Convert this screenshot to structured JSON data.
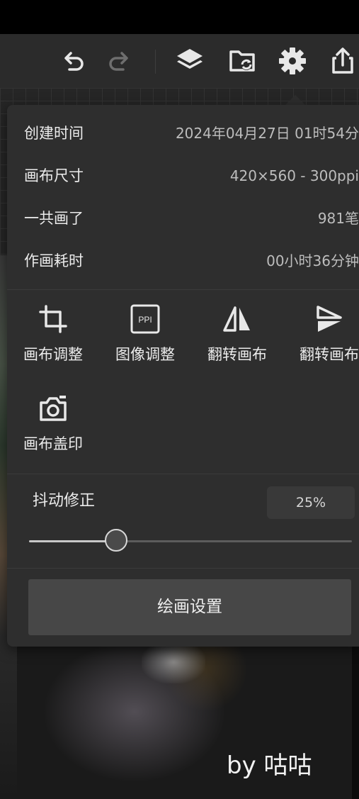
{
  "toolbar": {
    "icons": [
      "undo-icon",
      "redo-icon",
      "layers-icon",
      "folder-sync-icon",
      "gear-icon",
      "share-icon"
    ]
  },
  "info": {
    "rows": [
      {
        "label": "创建时间",
        "value": "2024年04月27日 01时54分"
      },
      {
        "label": "画布尺寸",
        "value": "420×560 - 300ppi"
      },
      {
        "label": "一共画了",
        "value": "981笔"
      },
      {
        "label": "作画耗时",
        "value": "00小时36分钟"
      }
    ]
  },
  "tools": {
    "items": [
      {
        "label": "画布调整",
        "icon": "crop-icon"
      },
      {
        "label": "图像调整",
        "icon": "ppi-icon",
        "icon_text": "PPI"
      },
      {
        "label": "翻转画布",
        "icon": "flip-horizontal-icon"
      },
      {
        "label": "翻转画布",
        "icon": "flip-vertical-icon"
      },
      {
        "label": "画布盖印",
        "icon": "camera-icon"
      }
    ]
  },
  "stabilizer": {
    "label": "抖动修正",
    "value_text": "25%",
    "value": 0.27
  },
  "draw_settings_label": "绘画设置",
  "signature": "by 咕咕",
  "colors": {
    "panel": "#2e2e2e",
    "toolbar": "#2b2b2b",
    "button": "#474747",
    "icon": "#e8e8e8",
    "icon_disabled": "#6e6e6e"
  }
}
